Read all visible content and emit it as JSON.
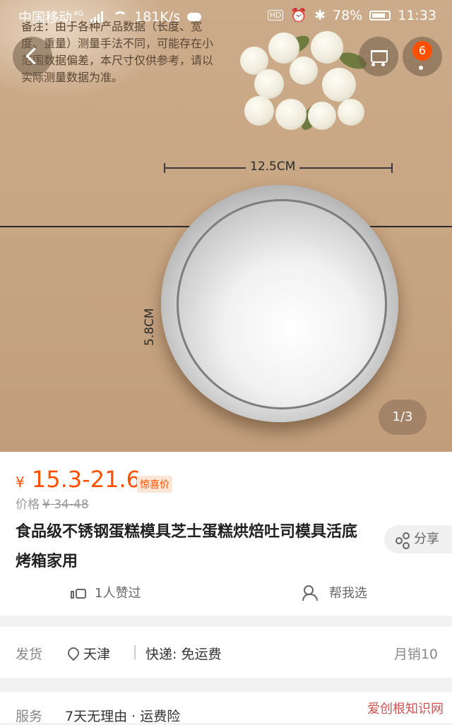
{
  "statusbar": {
    "carrier": "中国移动",
    "network": "4G",
    "speed": "181K/s",
    "hd": "HD",
    "battery": "78%",
    "time": "11:33"
  },
  "header": {
    "cart_badge": "6"
  },
  "gallery": {
    "note_text": "备注：由于各种产品数据（长度、宽度、重量）测量手法不同，可能存在小范围数据偏差，本尺寸仅供参考，请以实际测量数据为准。",
    "width_label": "12.5CM",
    "height_label": "5.8CM",
    "counter": "1/3"
  },
  "product": {
    "currency": "¥",
    "price_range": "15.3-21.6",
    "price_tag": "惊喜价",
    "orig_label": "价格",
    "orig_price": "¥ 34-48",
    "title": "食品级不锈钢蛋糕模具芝士蛋糕烘焙吐司模具活底烤箱家用",
    "share_label": "分享",
    "likes_label": "1人赞过",
    "help_label": "帮我选"
  },
  "shipping": {
    "label": "发货",
    "location": "天津",
    "express": "快递: 免运费",
    "monthly_sales": "月销10"
  },
  "service": {
    "label": "服务",
    "text": "7天无理由 · 运费险"
  },
  "watermark": "爱创根知识网"
}
